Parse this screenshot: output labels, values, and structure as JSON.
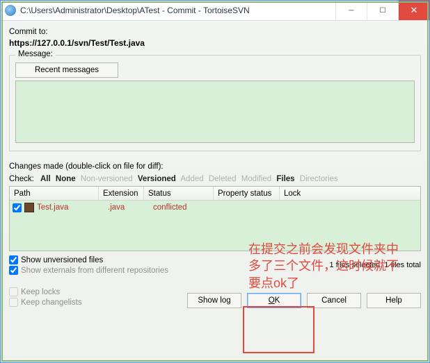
{
  "titlebar": {
    "title": "C:\\Users\\Administrator\\Desktop\\ATest - Commit - TortoiseSVN"
  },
  "commit": {
    "label": "Commit to:",
    "url": "https://127.0.0.1/svn/Test/Test.java"
  },
  "message": {
    "group_label": "Message:",
    "recent_btn": "Recent messages",
    "value": ""
  },
  "changes": {
    "made_label": "Changes made (double-click on file for diff):",
    "check_label": "Check:",
    "filters": {
      "all": "All",
      "none": "None",
      "nonversioned": "Non-versioned",
      "versioned": "Versioned",
      "added": "Added",
      "deleted": "Deleted",
      "modified": "Modified",
      "files": "Files",
      "directories": "Directories"
    },
    "columns": {
      "path": "Path",
      "ext": "Extension",
      "status": "Status",
      "prop": "Property status",
      "lock": "Lock"
    },
    "rows": [
      {
        "checked": true,
        "path": "Test.java",
        "ext": ".java",
        "status": "conflicted",
        "prop": "",
        "lock": ""
      }
    ],
    "show_unversioned": "Show unversioned files",
    "show_externals": "Show externals from different repositories",
    "status_text": "1 files selected, 1 files total"
  },
  "options": {
    "keep_locks": "Keep locks",
    "keep_changelists": "Keep changelists"
  },
  "buttons": {
    "show_log": "Show log",
    "ok": "OK",
    "cancel": "Cancel",
    "help": "Help"
  },
  "annotation": {
    "text": "在提交之前会发现文件夹中多了三个文件，这时候就不要点ok了"
  }
}
